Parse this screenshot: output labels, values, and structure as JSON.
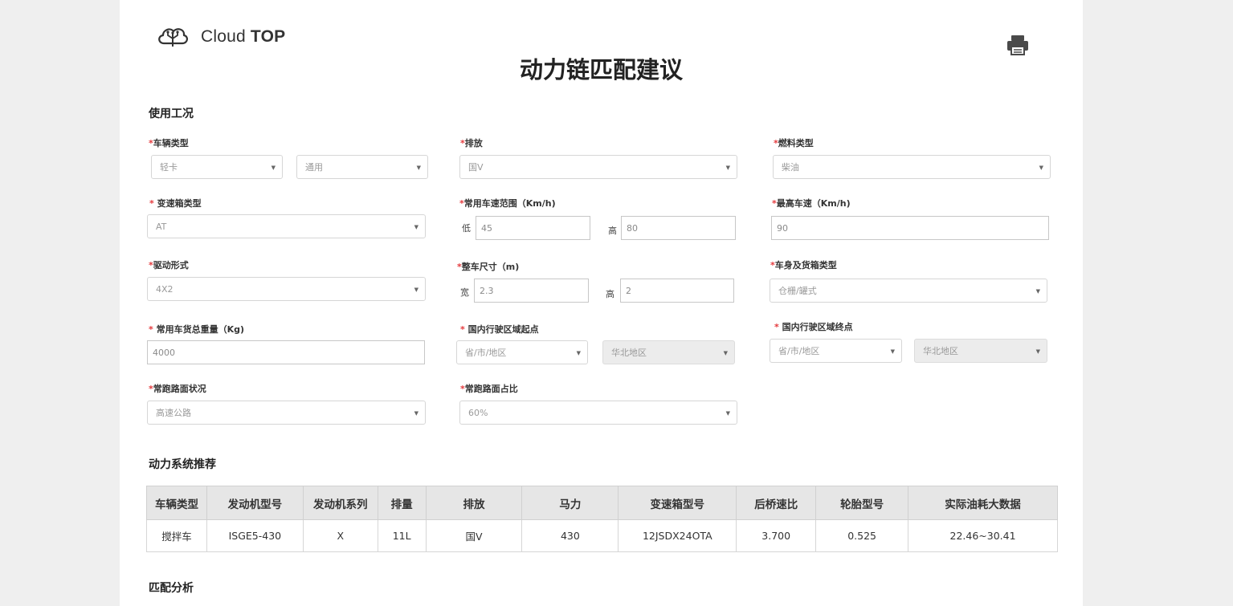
{
  "brand": {
    "name": "Cloud",
    "name_bold": "TOP"
  },
  "page_title": "动力链匹配建议",
  "sections": {
    "usage": "使用工况",
    "recommend": "动力系统推荐",
    "analysis": "匹配分析"
  },
  "form": {
    "vehicle_type": {
      "label": "车辆类型",
      "value": "轻卡",
      "sub_value": "通用"
    },
    "emission": {
      "label": "排放",
      "value": "国V"
    },
    "fuel_type": {
      "label": "燃料类型",
      "value": "柴油"
    },
    "gearbox_type": {
      "label": "变速箱类型",
      "value": "AT"
    },
    "speed_range": {
      "label": "常用车速范围（Km/h)",
      "low_label": "低",
      "low": "45",
      "high_label": "高",
      "high": "80"
    },
    "max_speed": {
      "label": "最高车速（Km/h)",
      "value": "90"
    },
    "drive_form": {
      "label": "驱动形式",
      "value": "4X2"
    },
    "vehicle_size": {
      "label": "整车尺寸（m)",
      "width_label": "宽",
      "width": "2.3",
      "height_label": "高",
      "height": "2"
    },
    "body_type": {
      "label": "车身及货箱类型",
      "value": "仓栅/罐式"
    },
    "gross_weight": {
      "label": "常用车货总重量（Kg)",
      "value": "4000"
    },
    "region_start": {
      "label": "国内行驶区域起点",
      "province": "省/市/地区",
      "area": "华北地区"
    },
    "region_end": {
      "label": "国内行驶区域终点",
      "province": "省/市/地区",
      "area": "华北地区"
    },
    "road_condition": {
      "label": "常跑路面状况",
      "value": "高速公路"
    },
    "road_ratio": {
      "label": "常跑路面占比",
      "value": "60%"
    }
  },
  "table": {
    "headers": [
      "车辆类型",
      "发动机型号",
      "发动机系列",
      "排量",
      "排放",
      "马力",
      "变速箱型号",
      "后桥速比",
      "轮胎型号",
      "实际油耗大数据"
    ],
    "rows": [
      [
        "搅拌车",
        "ISGE5-430",
        "X",
        "11L",
        "国V",
        "430",
        "12JSDX24OTA",
        "3.700",
        "0.525",
        "22.46~30.41"
      ]
    ]
  },
  "icons": {
    "logo": "cloud-logo-icon",
    "print": "printer-icon",
    "dropdown": "caret-down-icon"
  }
}
